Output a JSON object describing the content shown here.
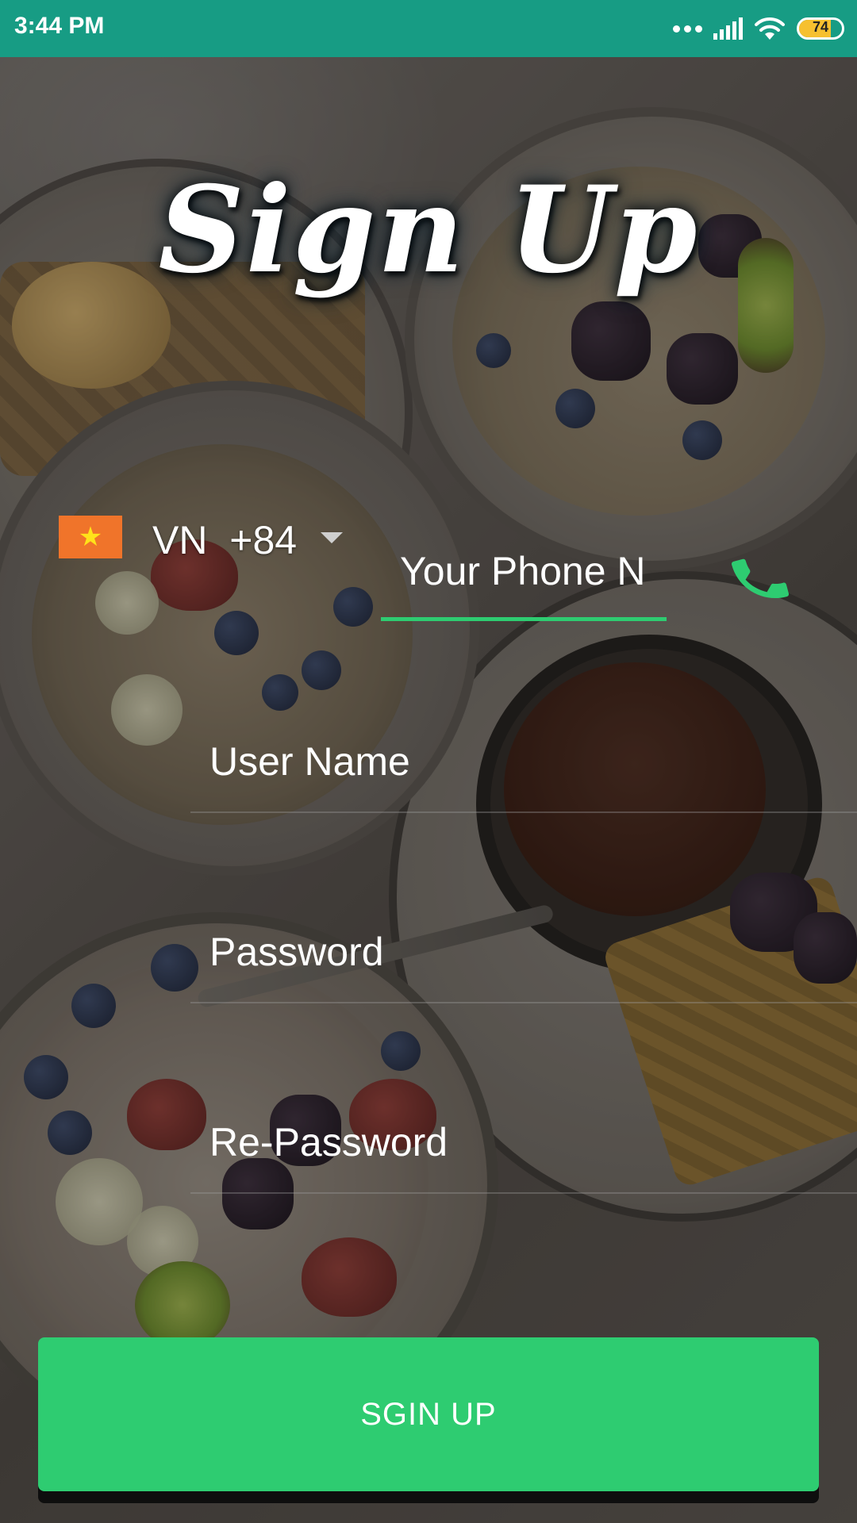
{
  "status_bar": {
    "time": "3:44 PM",
    "battery_level": "74",
    "icons": [
      "more-dots-icon",
      "signal-icon",
      "wifi-icon",
      "battery-icon"
    ]
  },
  "title": "Sign Up",
  "phone": {
    "country_flag_icon": "vietnam-flag-icon",
    "country_code": "VN  +84",
    "placeholder": "Your Phone Number",
    "icon": "phone-icon"
  },
  "fields": {
    "username_placeholder": "User Name",
    "password_placeholder": "Password",
    "repassword_placeholder": "Re-Password"
  },
  "signup_button": {
    "label": "SGIN UP"
  },
  "colors": {
    "status_bar": "#179c84",
    "accent": "#2ecc71",
    "flag_background": "#f0742a",
    "flag_star": "#ffe21a"
  }
}
